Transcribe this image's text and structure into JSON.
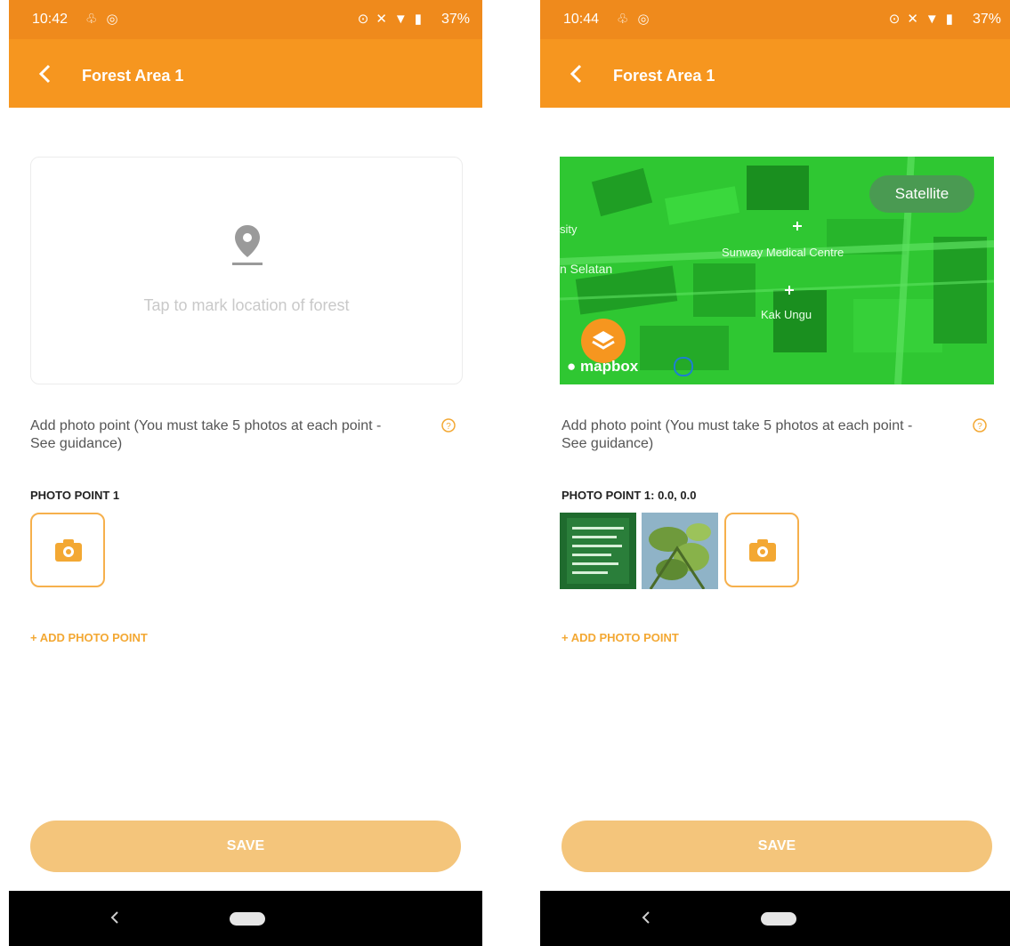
{
  "screens": [
    {
      "status": {
        "time": "10:42",
        "battery": "37%"
      },
      "appbar": {
        "title": "Forest Area 1"
      },
      "map": {
        "state": "empty",
        "hint": "Tap to mark location of forest"
      },
      "instructions": "Add photo point (You must take 5 photos at each point - See guidance)",
      "photo_point": {
        "label": "PHOTO POINT 1",
        "photos": 0
      },
      "add_photo_point": "+ ADD PHOTO POINT",
      "save_label": "SAVE"
    },
    {
      "status": {
        "time": "10:44",
        "battery": "37%"
      },
      "appbar": {
        "title": "Forest Area 1"
      },
      "map": {
        "state": "satellite",
        "style_button": "Satellite",
        "labels": [
          "Sunway Medical Centre",
          "n Selatan",
          "Kak Ungu",
          "sity"
        ],
        "attribution": "mapbox"
      },
      "instructions": "Add photo point (You must take 5 photos at each point - See guidance)",
      "photo_point": {
        "label": "PHOTO POINT 1: 0.0, 0.0",
        "photos": 2
      },
      "add_photo_point": "+ ADD PHOTO POINT",
      "save_label": "SAVE"
    }
  ],
  "colors": {
    "status_bar": "#ef8a1c",
    "app_bar": "#f6961f",
    "accent": "#f3a833",
    "save_disabled": "#f4c57b",
    "map_tint": "#2fc732"
  },
  "icons": {
    "back": "chevron-left-icon",
    "location": "map-pin-icon",
    "help": "question-circle-icon",
    "camera": "camera-icon",
    "layers": "layers-icon"
  }
}
